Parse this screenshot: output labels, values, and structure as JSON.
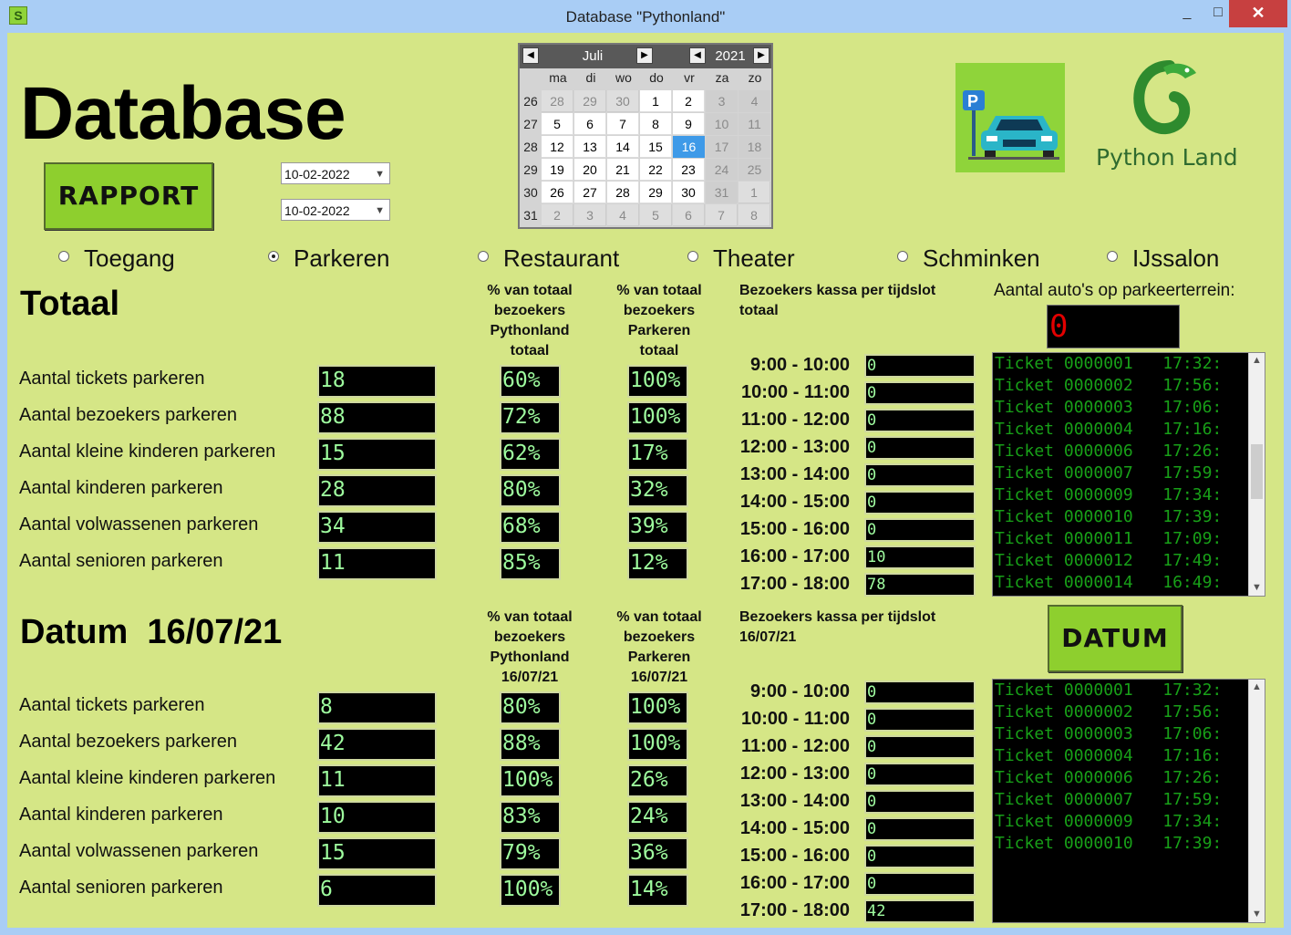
{
  "window": {
    "title": "Database \"Pythonland\"",
    "minimize": "_",
    "maximize": "□",
    "close": "✕"
  },
  "app_title": "Database",
  "buttons": {
    "rapport": "RAPPORT",
    "datum": "DATUM"
  },
  "date_selects": {
    "from": "10-02-2022",
    "to": "10-02-2022"
  },
  "calendar": {
    "month": "Juli",
    "year": "2021",
    "weekdays": [
      "ma",
      "di",
      "wo",
      "do",
      "vr",
      "za",
      "zo"
    ],
    "weeks": [
      {
        "wk": "26",
        "days": [
          "28",
          "29",
          "30",
          "1",
          "2",
          "3",
          "4"
        ]
      },
      {
        "wk": "27",
        "days": [
          "5",
          "6",
          "7",
          "8",
          "9",
          "10",
          "11"
        ]
      },
      {
        "wk": "28",
        "days": [
          "12",
          "13",
          "14",
          "15",
          "16",
          "17",
          "18"
        ]
      },
      {
        "wk": "29",
        "days": [
          "19",
          "20",
          "21",
          "22",
          "23",
          "24",
          "25"
        ]
      },
      {
        "wk": "30",
        "days": [
          "26",
          "27",
          "28",
          "29",
          "30",
          "31",
          "1"
        ]
      },
      {
        "wk": "31",
        "days": [
          "2",
          "3",
          "4",
          "5",
          "6",
          "7",
          "8"
        ]
      }
    ],
    "selected_day": "16"
  },
  "radios": [
    {
      "label": "Toegang",
      "selected": false
    },
    {
      "label": "Parkeren",
      "selected": true
    },
    {
      "label": "Restaurant",
      "selected": false
    },
    {
      "label": "Theater",
      "selected": false
    },
    {
      "label": "Schminken",
      "selected": false
    },
    {
      "label": "IJssalon",
      "selected": false
    }
  ],
  "logo_text": "Python Land",
  "totaal": {
    "title": "Totaal",
    "hdr_pct_pythonland": [
      "% van totaal",
      "bezoekers",
      "Pythonland",
      "totaal"
    ],
    "hdr_pct_parkeren": [
      "% van totaal",
      "bezoekers",
      "Parkeren",
      "totaal"
    ],
    "hdr_slots": [
      "Bezoekers kassa per tijdslot",
      "totaal"
    ],
    "rows": [
      {
        "label": "Aantal tickets parkeren",
        "value": "18",
        "pct1": "60%",
        "pct2": "100%"
      },
      {
        "label": "Aantal bezoekers parkeren",
        "value": "88",
        "pct1": "72%",
        "pct2": "100%"
      },
      {
        "label": "Aantal kleine kinderen parkeren",
        "value": "15",
        "pct1": "62%",
        "pct2": "17%"
      },
      {
        "label": "Aantal kinderen parkeren",
        "value": "28",
        "pct1": "80%",
        "pct2": "32%"
      },
      {
        "label": "Aantal volwassenen parkeren",
        "value": "34",
        "pct1": "68%",
        "pct2": "39%"
      },
      {
        "label": "Aantal senioren parkeren",
        "value": "11",
        "pct1": "85%",
        "pct2": "12%"
      }
    ],
    "slots": [
      {
        "label": "9:00 - 10:00",
        "value": "0"
      },
      {
        "label": "10:00 - 11:00",
        "value": "0"
      },
      {
        "label": "11:00 - 12:00",
        "value": "0"
      },
      {
        "label": "12:00 - 13:00",
        "value": "0"
      },
      {
        "label": "13:00 - 14:00",
        "value": "0"
      },
      {
        "label": "14:00 - 15:00",
        "value": "0"
      },
      {
        "label": "15:00 - 16:00",
        "value": "0"
      },
      {
        "label": "16:00 - 17:00",
        "value": "10"
      },
      {
        "label": "17:00 - 18:00",
        "value": "78"
      }
    ],
    "cars_label": "Aantal auto's op parkeerterrein:",
    "cars_count": "0",
    "tickets": [
      "Ticket 0000001   17:32:",
      "Ticket 0000002   17:56:",
      "Ticket 0000003   17:06:",
      "Ticket 0000004   17:16:",
      "Ticket 0000006   17:26:",
      "Ticket 0000007   17:59:",
      "Ticket 0000009   17:34:",
      "Ticket 0000010   17:39:",
      "Ticket 0000011   17:09:",
      "Ticket 0000012   17:49:",
      "Ticket 0000014   16:49:"
    ]
  },
  "datum": {
    "title": "Datum  16/07/21",
    "hdr_pct_pythonland": [
      "% van totaal",
      "bezoekers",
      "Pythonland",
      "16/07/21"
    ],
    "hdr_pct_parkeren": [
      "% van totaal",
      "bezoekers",
      "Parkeren",
      "16/07/21"
    ],
    "hdr_slots": [
      "Bezoekers kassa per tijdslot",
      "16/07/21"
    ],
    "rows": [
      {
        "label": "Aantal tickets parkeren",
        "value": "8",
        "pct1": "80%",
        "pct2": "100%"
      },
      {
        "label": "Aantal bezoekers parkeren",
        "value": "42",
        "pct1": "88%",
        "pct2": "100%"
      },
      {
        "label": "Aantal kleine kinderen parkeren",
        "value": "11",
        "pct1": "100%",
        "pct2": "26%"
      },
      {
        "label": "Aantal kinderen parkeren",
        "value": "10",
        "pct1": "83%",
        "pct2": "24%"
      },
      {
        "label": "Aantal volwassenen parkeren",
        "value": "15",
        "pct1": "79%",
        "pct2": "36%"
      },
      {
        "label": "Aantal senioren parkeren",
        "value": "6",
        "pct1": "100%",
        "pct2": "14%"
      }
    ],
    "slots": [
      {
        "label": "9:00 - 10:00",
        "value": "0"
      },
      {
        "label": "10:00 - 11:00",
        "value": "0"
      },
      {
        "label": "11:00 - 12:00",
        "value": "0"
      },
      {
        "label": "12:00 - 13:00",
        "value": "0"
      },
      {
        "label": "13:00 - 14:00",
        "value": "0"
      },
      {
        "label": "14:00 - 15:00",
        "value": "0"
      },
      {
        "label": "15:00 - 16:00",
        "value": "0"
      },
      {
        "label": "16:00 - 17:00",
        "value": "0"
      },
      {
        "label": "17:00 - 18:00",
        "value": "42"
      }
    ],
    "tickets": [
      "Ticket 0000001   17:32:",
      "Ticket 0000002   17:56:",
      "Ticket 0000003   17:06:",
      "Ticket 0000004   17:16:",
      "Ticket 0000006   17:26:",
      "Ticket 0000007   17:59:",
      "Ticket 0000009   17:34:",
      "Ticket 0000010   17:39:"
    ]
  },
  "colors": {
    "background": "#d5e686",
    "button": "#8ecf2e",
    "lcd_text": "#9efc9e",
    "ticket_text": "#18a018",
    "counter_text": "#e20000",
    "calendar_selected": "#3e9ae8"
  }
}
